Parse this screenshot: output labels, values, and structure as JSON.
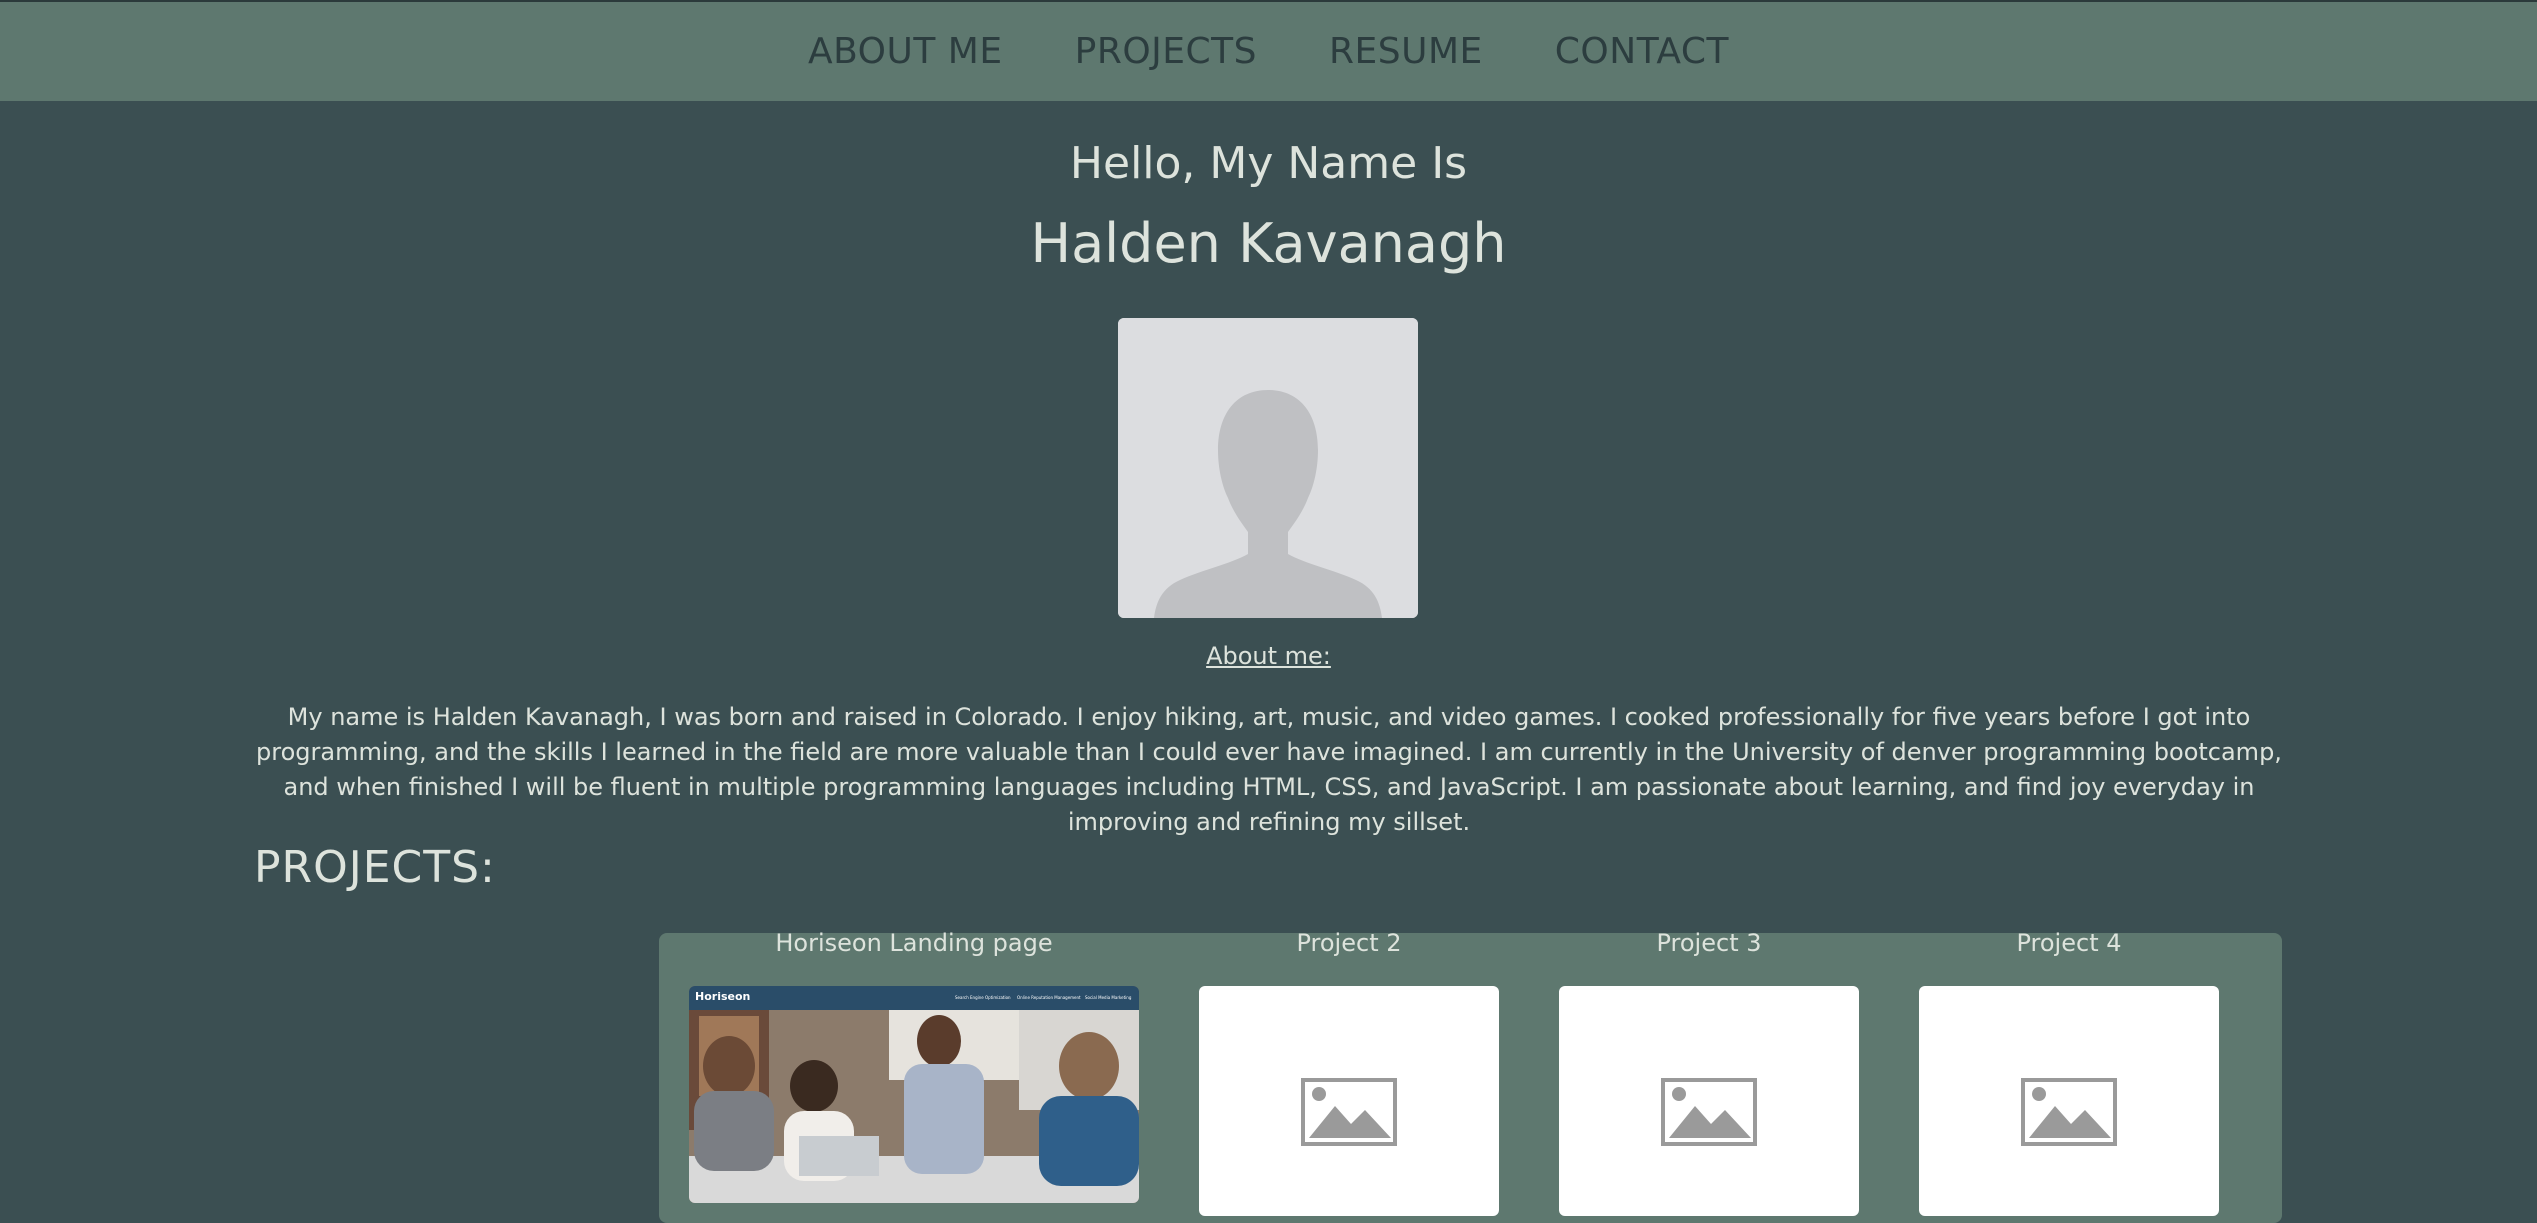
{
  "nav": {
    "items": [
      {
        "label": "ABOUT ME"
      },
      {
        "label": "PROJECTS"
      },
      {
        "label": "RESUME"
      },
      {
        "label": "CONTACT"
      }
    ]
  },
  "hero": {
    "greeting": "Hello, My Name Is",
    "name": "Halden Kavanagh"
  },
  "about": {
    "heading": "About me:",
    "text": "My name is Halden Kavanagh, I was born and raised in Colorado. I enjoy hiking, art, music, and video games. I cooked professionally for five years before I got into programming, and the skills I learned in the field are more valuable than I could ever have imagined. I am currently in the University of denver programming bootcamp, and when finished I will be fluent in multiple programming languages including HTML, CSS, and JavaScript. I am passionate about learning, and find joy everyday in improving and refining my sillset."
  },
  "projects": {
    "heading": "PROJECTS:",
    "items": [
      {
        "title": "Horiseon Landing page",
        "thumb_brand": "Horiseon",
        "thumb_nav": [
          "Search Engine Optimization",
          "Online Reputation Management",
          "Social Media Marketing"
        ]
      },
      {
        "title": "Project 2"
      },
      {
        "title": "Project 3"
      },
      {
        "title": "Project 4"
      }
    ]
  },
  "colors": {
    "background": "#3b4f52",
    "nav_background": "#5e786f",
    "nav_text": "#2c3d3f",
    "text": "#dde3dc"
  }
}
